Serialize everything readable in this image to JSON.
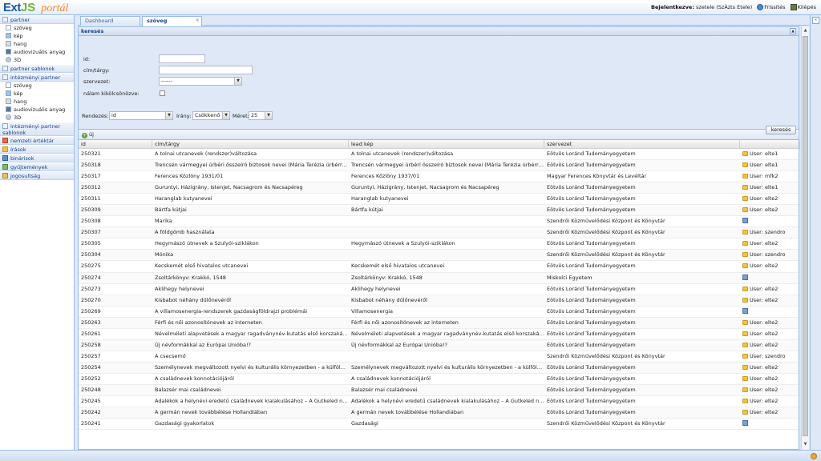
{
  "header": {
    "logo_ext": "Ext",
    "logo_js": "JS",
    "logo_portal": "portál",
    "login_prefix": "Bejelentkezve:",
    "login_user": "szetele (SzÁzts Etele)",
    "refresh_label": "Frissítés",
    "logout_label": "Kilépés"
  },
  "sidebar": {
    "partner": "partner",
    "partner_items": [
      "szöveg",
      "kép",
      "hang",
      "audiovizuális anyag",
      "3D"
    ],
    "partner_sablonok": "partner sablonok",
    "intezmenyi_partner": "intézményi partner",
    "intezmenyi_items": [
      "szöveg",
      "kép",
      "hang",
      "audiovizuális anyag",
      "3D"
    ],
    "intezmenyi_sablonok": "intézményi partner sablonok",
    "nemzeti": "nemzeti értéktár",
    "irasok": "írások",
    "binarisok": "binárisok",
    "gyujtemenyek": "gyűjtemények",
    "jogosultsag": "jogosultság"
  },
  "tabs": {
    "dashboard": "Dashboard",
    "szoveg": "szöveg",
    "close": "×"
  },
  "search": {
    "title": "keresés",
    "id_label": "id:",
    "id_value": "",
    "cim_label": "cím/tárgy:",
    "cim_value": "",
    "szervezet_label": "szervezet:",
    "szervezet_value": "------",
    "nalam_label": "nálam kikölcsönözve:",
    "rendezes_label": "Rendezés:",
    "rendezes_value": "id",
    "irany_label": "Irány:",
    "irany_value": "Csökkenő",
    "meret_label": "Méret:",
    "meret_value": "25",
    "button": "keresés"
  },
  "toolbar": {
    "new_label": "új"
  },
  "grid": {
    "columns": [
      "id",
      "cím/tárgy",
      "lead kép",
      "szervezet",
      ""
    ],
    "rows": [
      {
        "id": "250321",
        "title": "A tolnai utcanevek (rendszer)változása",
        "lead": "A tolnai utcanevek (rendszer)változása",
        "org": "Eötvös Loránd Tudományegyetem",
        "user": "User: elte1",
        "locked": true
      },
      {
        "id": "250318",
        "title": "Trencsén vármegyei úrbéri összeíró biztosok nevei (Mária Terézia úrbérrendez...",
        "lead": "Trencsén vármegyei úrbéri összeíró biztosok nevei (Mária Terézia úrbérrendez...",
        "org": "Eötvös Loránd Tudományegyetem",
        "user": "User: elte1",
        "locked": true
      },
      {
        "id": "250317",
        "title": "Ferences Közlöny 1931/01",
        "lead": "Ferences Közlöny 1937/01",
        "org": "Magyar Ferences Könyvtár és Levéltár",
        "user": "User: mfk2",
        "locked": true
      },
      {
        "id": "250312",
        "title": "Guruntyi, Házigrány, Istenjet, Nacsagrom és Nacsapéreg",
        "lead": "Guruntyi, Házigrány, Istenjet, Nacsagrom és Nacsapéreg",
        "org": "Eötvös Loránd Tudományegyetem",
        "user": "User: elte1",
        "locked": true
      },
      {
        "id": "250311",
        "title": "Haranglab kutyanevei",
        "lead": "Haranglab kutyanevei",
        "org": "Eötvös Loránd Tudományegyetem",
        "user": "User: elte2",
        "locked": true
      },
      {
        "id": "250309",
        "title": "Bártfa kútjai",
        "lead": "Bártfa kútjai",
        "org": "Eötvös Loránd Tudományegyetem",
        "user": "User: elte2",
        "locked": true
      },
      {
        "id": "250308",
        "title": "Marika",
        "lead": "",
        "org": "Szendrői Közművelődési Központ és Könyvtár",
        "user": "",
        "locked": false
      },
      {
        "id": "250307",
        "title": "A földgömb használata",
        "lead": "",
        "org": "Szendrői Közművelődési Központ és Könyvtár",
        "user": "User: szendro",
        "locked": true
      },
      {
        "id": "250305",
        "title": "Hegymászó útnevek a Szulyói-sziklákon",
        "lead": "Hegymászó útnevek a Szulyói-sziklákon",
        "org": "Eötvös Loránd Tudományegyetem",
        "user": "User: elte2",
        "locked": true
      },
      {
        "id": "250304",
        "title": "Mónika",
        "lead": "",
        "org": "Szendrői Közművelődési Központ és Könyvtár",
        "user": "User: szendro",
        "locked": true
      },
      {
        "id": "250275",
        "title": "Kecskemét első hivatalos utcanevei",
        "lead": "Kecskemét első hivatalos utcanevei",
        "org": "Eötvös Loránd Tudományegyetem",
        "user": "User: elte2",
        "locked": true
      },
      {
        "id": "250274",
        "title": "Zsoltárkönyv: Krakkó, 1548",
        "lead": "Zsoltárkönyv: Krakkó, 1548",
        "org": "Miskolci Egyetem",
        "user": "",
        "locked": false
      },
      {
        "id": "250273",
        "title": "Aklihegy helynevei",
        "lead": "Aklihegy helynevei",
        "org": "Eötvös Loránd Tudományegyetem",
        "user": "User: elte2",
        "locked": true
      },
      {
        "id": "250270",
        "title": "Kisbabot néhány dűlőnevéről",
        "lead": "Kisbabot néhány dűlőnevéről",
        "org": "Eötvös Loránd Tudományegyetem",
        "user": "User: elte2",
        "locked": true
      },
      {
        "id": "250269",
        "title": "A villamosenergia-rendszerek gazdaságföldrajzi problémái",
        "lead": "Villamosenergia",
        "org": "Eötvös Loránd Tudományegyetem",
        "user": "",
        "locked": false
      },
      {
        "id": "250263",
        "title": "Férfi és női azonosítónevek az interneten",
        "lead": "Férfi és női azonosítónevek az interneten",
        "org": "Eötvös Loránd Tudományegyetem",
        "user": "User: elte2",
        "locked": true
      },
      {
        "id": "250261",
        "title": "Névelméleti alapvetések a magyar ragadványnév-kutatás első korszakában (1...",
        "lead": "Névelméleti alapvetések a magyar ragadványnév-kutatás első korszakában (1...",
        "org": "Eötvös Loránd Tudományegyetem",
        "user": "User: elte2",
        "locked": true
      },
      {
        "id": "250258",
        "title": "Új névformákkal az Európai Unióba!?",
        "lead": "Új névformákkal az Európai Unióba!?",
        "org": "Eötvös Loránd Tudományegyetem",
        "user": "User: elte2",
        "locked": true
      },
      {
        "id": "250257",
        "title": "A csecsemő",
        "lead": "",
        "org": "Szendrői Közművelődési Központ és Könyvtár",
        "user": "User: szendro",
        "locked": true
      },
      {
        "id": "250254",
        "title": "Személynevek megváltozott nyelvi és kulturális környezetben - a külföldön élő ...",
        "lead": "Személynevek megváltozott nyelvi és kulturális környezetben - a külföldön élő ...",
        "org": "Eötvös Loránd Tudományegyetem",
        "user": "User: elte2",
        "locked": true
      },
      {
        "id": "250252",
        "title": "A családnevek konnotációjáról",
        "lead": "A családnevek konnotációjáról",
        "org": "Eötvös Loránd Tudományegyetem",
        "user": "User: elte2",
        "locked": true
      },
      {
        "id": "250248",
        "title": "Balazsér mai családnevei",
        "lead": "Balazsér mai családnevei",
        "org": "Eötvös Loránd Tudományegyetem",
        "user": "User: elte2",
        "locked": true
      },
      {
        "id": "250245",
        "title": "Adalékok a helynévi eredetű családnevek kialakulásához – A Gutkeled nemze...",
        "lead": "Adalékok a helynévi eredetű családnevek kialakulásához – A Gutkeled nemze...",
        "org": "Eötvös Loránd Tudományegyetem",
        "user": "User: elte2",
        "locked": true
      },
      {
        "id": "250242",
        "title": "A germán nevek továbbélése Hollandiában",
        "lead": "A germán nevek továbbélése Hollandiában",
        "org": "Eötvös Loránd Tudományegyetem",
        "user": "User: elte2",
        "locked": true
      },
      {
        "id": "250241",
        "title": "Gazdasági gyakorlatok",
        "lead": "Gazdasági",
        "org": "Szendrői Közművelődési Központ és Könyvtár",
        "user": "",
        "locked": false
      }
    ]
  }
}
